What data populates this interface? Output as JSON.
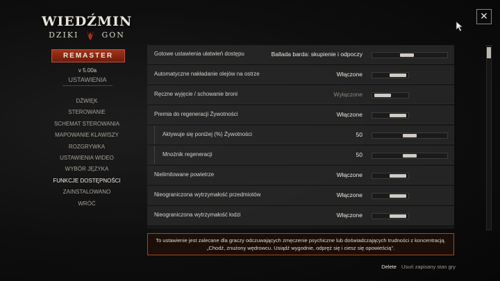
{
  "logo": {
    "title": "WIEDŹMIN",
    "subtitle_left": "DZIKI",
    "subtitle_right": "GON",
    "badge": "REMASTER"
  },
  "version": "v 5.00a",
  "section_title": "USTAWIENIA",
  "menu": {
    "items": [
      {
        "label": "DŹWIĘK",
        "active": false
      },
      {
        "label": "STEROWANIE",
        "active": false
      },
      {
        "label": "SCHEMAT STEROWANIA",
        "active": false
      },
      {
        "label": "MAPOWANIE KLAWISZY",
        "active": false
      },
      {
        "label": "ROZGRYWKA",
        "active": false
      },
      {
        "label": "USTAWIENIA WIDEO",
        "active": false
      },
      {
        "label": "WYBÓR JĘZYKA",
        "active": false
      },
      {
        "label": "FUNKCJE DOSTĘPNOŚCI",
        "active": true
      },
      {
        "label": "ZAINSTALOWANO",
        "active": false
      },
      {
        "label": "WRÓĆ",
        "active": false
      }
    ]
  },
  "settings": [
    {
      "label": "Gotowe ustawienia ułatwień dostępu",
      "value": "Ballada barda: skupienie i odpoczy",
      "slider_level": 0.45,
      "dim": false,
      "sub": false
    },
    {
      "label": "Automatyczne nakładanie olejów na ostrze",
      "value": "Włączone",
      "slider_level": 1,
      "dim": false,
      "sub": false
    },
    {
      "label": "Ręczne wyjęcie / schowanie broni",
      "value": "Wyłączone",
      "slider_level": 0,
      "dim": true,
      "sub": false
    },
    {
      "label": "Premia do regeneracji Żywotności",
      "value": "Włączone",
      "slider_level": 1,
      "dim": false,
      "sub": false
    },
    {
      "label": "Aktywuje się poniżej (%) Żywotności",
      "value": "50",
      "slider_level": 0.5,
      "dim": false,
      "sub": true
    },
    {
      "label": "Mnożnik regeneracji",
      "value": "50",
      "slider_level": 0.5,
      "dim": false,
      "sub": true
    },
    {
      "label": "Nielimitowane powietrze",
      "value": "Włączone",
      "slider_level": 1,
      "dim": false,
      "sub": false
    },
    {
      "label": "Nieograniczona wytrzymałość przedmiotów",
      "value": "Włączone",
      "slider_level": 1,
      "dim": false,
      "sub": false
    },
    {
      "label": "Nieograniczona wytrzymałość łodzi",
      "value": "Włączone",
      "slider_level": 1,
      "dim": false,
      "sub": false
    }
  ],
  "description": {
    "line1": "To ustawienie jest zalecane dla graczy odczuwających zmęczenie psychiczne lub doświadczających trudności z koncentracją.",
    "line2": "„Chodź, znużony wędrowcu. Usiądź wygodnie, odpręż się i ciesz się opowieścią”."
  },
  "footer": {
    "key": "Delete",
    "action": "Usuń zapisany stan gry"
  },
  "close_icon": "✕",
  "colors": {
    "accent": "#a34a1c",
    "badge": "#8e2a14"
  }
}
